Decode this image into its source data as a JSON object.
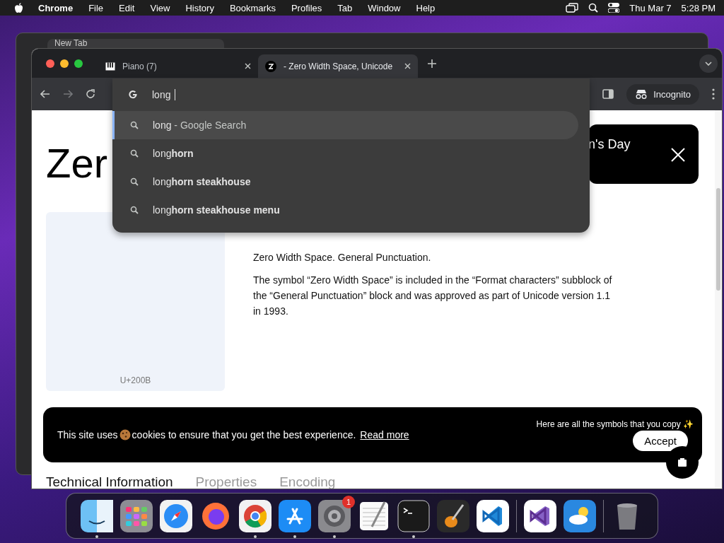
{
  "menubar": {
    "app": "Chrome",
    "menus": [
      "File",
      "Edit",
      "View",
      "History",
      "Bookmarks",
      "Profiles",
      "Tab",
      "Window",
      "Help"
    ],
    "date": "Thu Mar 7",
    "time": "5:28 PM"
  },
  "back_window": {
    "tab": "New Tab"
  },
  "window": {
    "tabs": [
      {
        "title": "Piano (7)",
        "kind": "piano",
        "selected": false
      },
      {
        "title": "- Zero Width Space, Unicode",
        "kind": "symbol",
        "selected": true
      }
    ],
    "omnibox": {
      "value": "long",
      "suggestions": [
        {
          "text": "long",
          "suffix": "- Google Search",
          "selected": true
        },
        {
          "text": "long**horn**",
          "selected": false
        },
        {
          "text": "long**horn steakhouse**",
          "selected": false
        },
        {
          "text": "long**horn steakhouse menu**",
          "selected": false
        }
      ]
    },
    "incognito": "Incognito"
  },
  "page": {
    "heading": "Zer",
    "banner": "n's Day",
    "symbol_code": "U+200B",
    "paragraphs": [
      "Zero Width Space. General Punctuation.",
      "The symbol “Zero Width Space” is included in the “Format characters” subblock of the “General Punctuation” block and was approved as part of Unicode version 1.1 in 1993."
    ],
    "cookie": {
      "before": "This site uses",
      "after": "cookies to ensure that you get the best experience.",
      "link": "Read more",
      "hint": "Here are all the symbols that you copy ✨",
      "button": "Accept"
    },
    "tabs": [
      {
        "label": "Technical Information",
        "selected": true
      },
      {
        "label": "Properties",
        "selected": false
      },
      {
        "label": "Encoding",
        "selected": false
      }
    ]
  },
  "dock": [
    {
      "kind": "finder",
      "running": true
    },
    {
      "kind": "launchpad",
      "running": false
    },
    {
      "kind": "safari",
      "running": false
    },
    {
      "kind": "firefox",
      "running": false
    },
    {
      "kind": "chrome",
      "running": true
    },
    {
      "kind": "appstore",
      "running": true
    },
    {
      "kind": "settings",
      "running": true,
      "badge": "1"
    },
    {
      "kind": "textedit",
      "running": false
    },
    {
      "kind": "terminal",
      "running": true
    },
    {
      "kind": "garageband",
      "running": false
    },
    {
      "kind": "vscode",
      "running": false
    },
    {
      "kind": "divider"
    },
    {
      "kind": "visualstudio",
      "running": false
    },
    {
      "kind": "weather",
      "running": false
    },
    {
      "kind": "divider"
    },
    {
      "kind": "trash",
      "running": false
    }
  ]
}
